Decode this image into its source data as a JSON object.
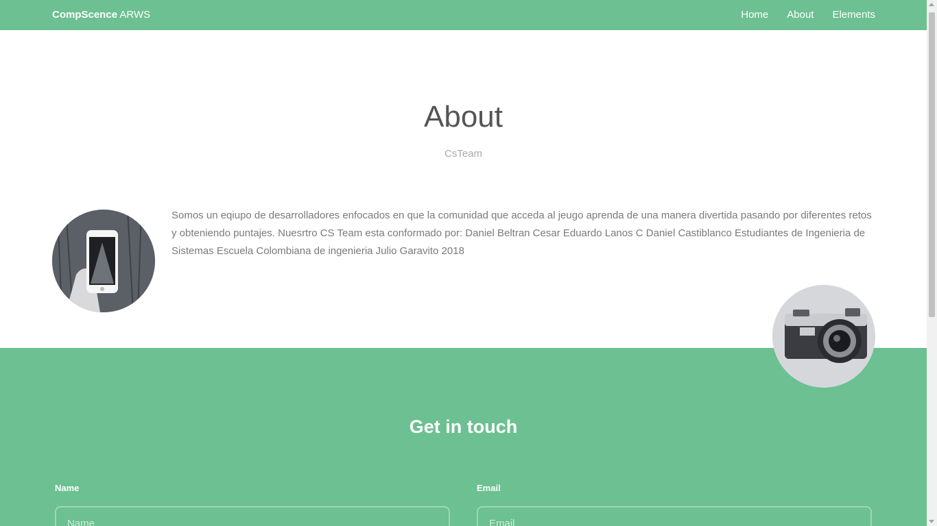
{
  "navbar": {
    "brand_bold": "CompScence",
    "brand_rest": " ARWS",
    "links": [
      "Home",
      "About",
      "Elements"
    ]
  },
  "about": {
    "title": "About",
    "subtitle": "CsTeam",
    "text": "Somos un eqiupo de desarrolladores enfocados en que la comunidad que acceda al jeugo aprenda de una manera divertida pasando por diferentes retos y obteniendo puntajes. Nuesrtro CS Team esta conformado por: Daniel Beltran Cesar Eduardo Lanos C Daniel Castiblanco Estudiantes de Ingenieria de Sistemas Escuela Colombiana de ingenieria Julio Garavito 2018"
  },
  "contact": {
    "title": "Get in touch",
    "name_label": "Name",
    "name_placeholder": "Name",
    "email_label": "Email",
    "email_placeholder": "Email"
  },
  "colors": {
    "accent": "#6cc091",
    "text_muted": "#7a7a7a"
  },
  "icons": {
    "phone_image": "phone-photo-icon",
    "camera_image": "camera-photo-icon"
  }
}
